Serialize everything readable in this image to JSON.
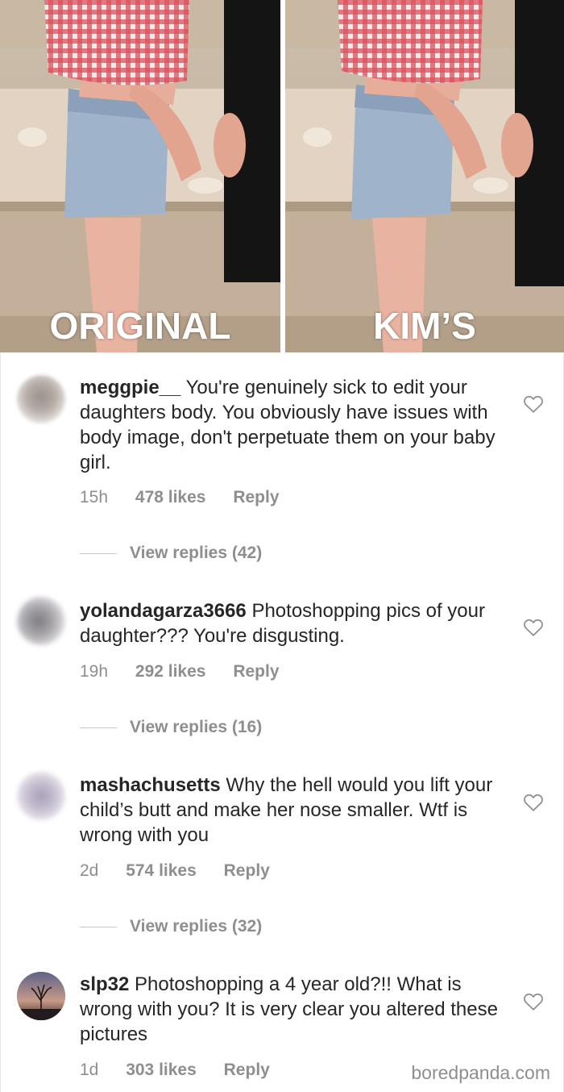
{
  "photos": {
    "left_caption": "ORIGINAL",
    "right_caption": "KIM’S"
  },
  "comments": [
    {
      "username": "meggpie__",
      "text": "You're genuinely sick to edit your daughters body. You obviously have issues with body image, don't perpetuate them on your baby girl.",
      "time": "15h",
      "likes": "478 likes",
      "reply": "Reply",
      "view_replies": "View replies (42)"
    },
    {
      "username": "yolandagarza3666",
      "text": "Photoshopping pics of your daughter??? You're disgusting.",
      "time": "19h",
      "likes": "292 likes",
      "reply": "Reply",
      "view_replies": "View replies (16)"
    },
    {
      "username": "mashachusetts",
      "text": "Why the hell would you lift your child’s butt and make her nose smaller. Wtf is wrong with you",
      "time": "2d",
      "likes": "574 likes",
      "reply": "Reply",
      "view_replies": "View replies (32)"
    },
    {
      "username": "slp32",
      "text": "Photoshopping a 4 year old?!! What is wrong with you? It is very clear you altered these pictures",
      "time": "1d",
      "likes": "303 likes",
      "reply": "Reply"
    }
  ],
  "watermark": "boredpanda.com",
  "icons": {
    "like": "heart-outline-icon"
  },
  "colors": {
    "text": "#262626",
    "meta": "#8e8e8e",
    "shirt_red": "#c8323a"
  }
}
